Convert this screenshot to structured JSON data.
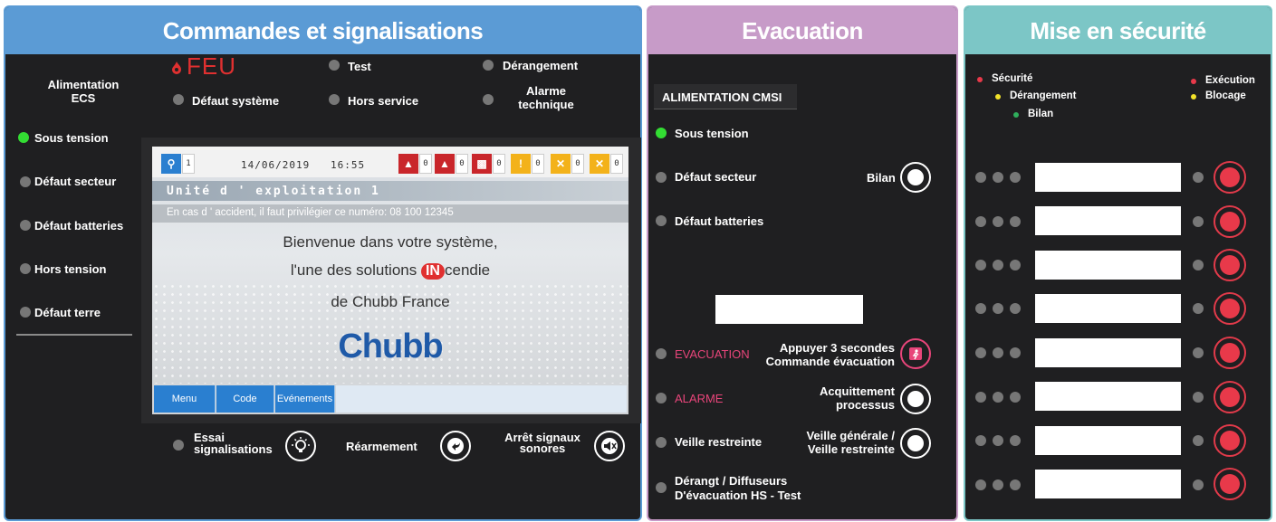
{
  "colors": {
    "commandes": "#5b9bd5",
    "evacuation": "#c79bc8",
    "securite": "#7cc6c6",
    "fire_red": "#e03030",
    "alarm_pink": "#e8457a",
    "led_green": "#33dd33"
  },
  "commandes": {
    "title": "Commandes et signalisations",
    "feu": "FEU",
    "test": "Test",
    "derangement": "Dérangement",
    "defaut_systeme": "Défaut système",
    "hors_service": "Hors service",
    "alarme_technique_1": "Alarme",
    "alarme_technique_2": "technique",
    "alimentation_1": "Alimentation",
    "alimentation_2": "ECS",
    "side": {
      "sous_tension": "Sous tension",
      "defaut_secteur": "Défaut secteur",
      "defaut_batteries": "Défaut batteries",
      "hors_tension": "Hors tension",
      "defaut_terre": "Défaut terre"
    },
    "screen": {
      "date": "14/06/2019",
      "time": "16:55",
      "key_count": "1",
      "counts": [
        "0",
        "0",
        "0",
        "0",
        "0",
        "0"
      ],
      "unit": "Unité d ' exploitation 1",
      "accident": "En cas d ' accident, il faut privilégier ce numéro: 08 100 12345",
      "welcome_1": "Bienvenue dans votre système,",
      "welcome_2a": "l'une des solutions",
      "welcome_logo": "IN",
      "welcome_2b": "cendie",
      "welcome_3": "de Chubb France",
      "brand": "Chubb",
      "menu": "Menu",
      "code": "Code",
      "events": "Evénements"
    },
    "bottom": {
      "essai_1": "Essai",
      "essai_2": "signalisations",
      "rearmement": "Réarmement",
      "arret_1": "Arrêt signaux",
      "arret_2": "sonores"
    }
  },
  "evacuation": {
    "title": "Evacuation",
    "alimentation": "ALIMENTATION CMSI",
    "sous_tension": "Sous tension",
    "defaut_secteur": "Défaut secteur",
    "bilan": "Bilan",
    "defaut_batteries": "Défaut batteries",
    "evacuation": "EVACUATION",
    "appuyer_1": "Appuyer 3 secondes",
    "appuyer_2": "Commande évacuation",
    "alarme": "ALARME",
    "acquittement_1": "Acquittement",
    "acquittement_2": "processus",
    "veille_restreinte": "Veille restreinte",
    "veille_generale_1": "Veille générale /",
    "veille_generale_2": "Veille restreinte",
    "derangt_1": "Dérangt / Diffuseurs",
    "derangt_2": "D'évacuation HS - Test"
  },
  "securite": {
    "title": "Mise en sécurité",
    "legend": {
      "securite": "Sécurité",
      "derangement": "Dérangement",
      "bilan": "Bilan",
      "execution": "Exécution",
      "blocage": "Blocage"
    }
  }
}
